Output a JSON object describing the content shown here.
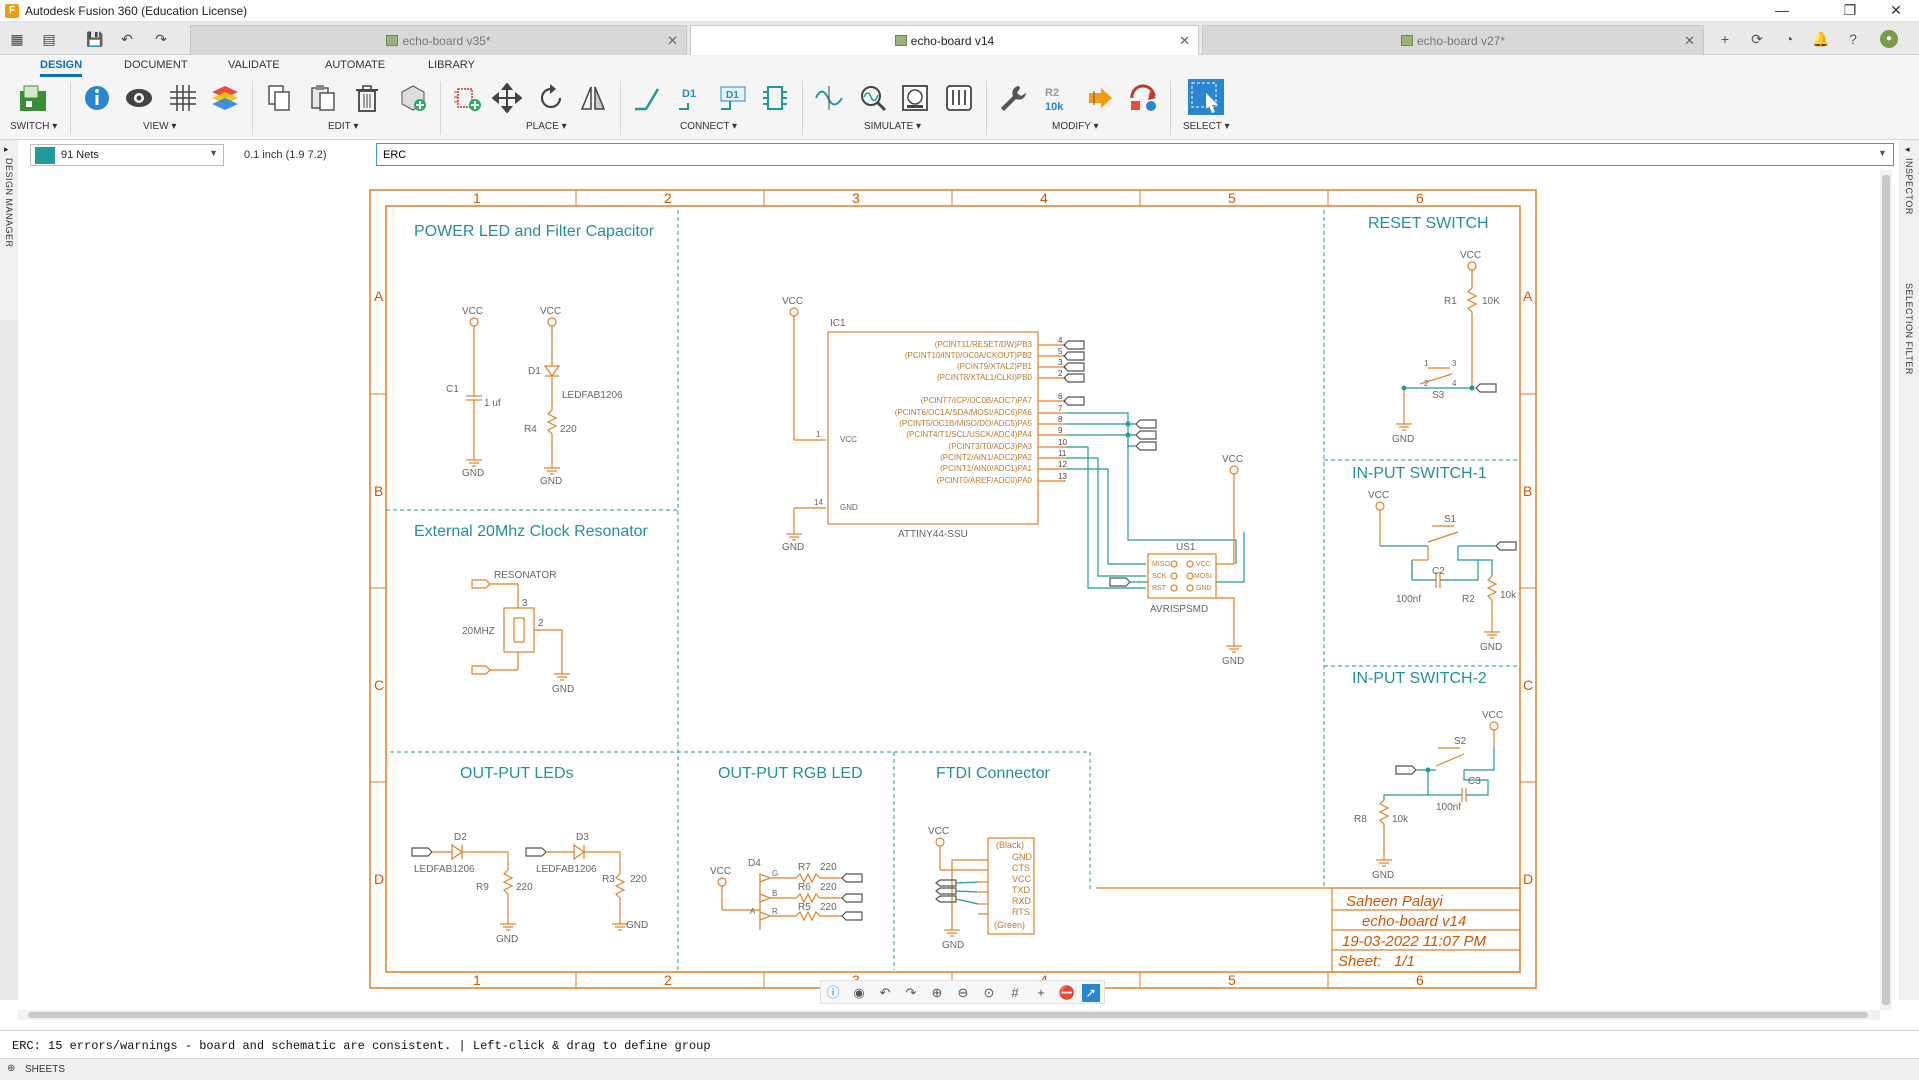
{
  "window": {
    "title": "Autodesk Fusion 360 (Education License)"
  },
  "tabs": [
    {
      "label": "echo-board v35*",
      "active": false
    },
    {
      "label": "echo-board v14",
      "active": true
    },
    {
      "label": "echo-board v27*",
      "active": false
    }
  ],
  "ribbon": {
    "tabs": [
      "DESIGN",
      "DOCUMENT",
      "VALIDATE",
      "AUTOMATE",
      "LIBRARY"
    ],
    "groups": {
      "switch": "SWITCH ▾",
      "view": "VIEW ▾",
      "edit": "EDIT ▾",
      "place": "PLACE ▾",
      "connect": "CONNECT ▾",
      "simulate": "SIMULATE ▾",
      "modify": "MODIFY ▾",
      "select": "SELECT ▾"
    },
    "icon_text": {
      "d1": "D1",
      "r2": "R2",
      "r2_value": "10k"
    }
  },
  "command_row": {
    "nets": "91 Nets",
    "grid": "0.1 inch (1.9 7.2)",
    "command": "ERC"
  },
  "side_panels": {
    "left": "DESIGN MANAGER",
    "right_top": "INSPECTOR",
    "right_bottom": "SELECTION FILTER"
  },
  "schematic": {
    "sections": {
      "power": "POWER LED and Filter Capacitor",
      "clock": "External 20Mhz Clock Resonator",
      "reset": "RESET SWITCH",
      "in1": "IN-PUT SWITCH-1",
      "in2": "IN-PUT SWITCH-2",
      "out_leds": "OUT-PUT LEDs",
      "out_rgb": "OUT-PUT RGB LED",
      "ftdi": "FTDI Connector"
    },
    "cols": [
      "1",
      "2",
      "3",
      "4",
      "5",
      "6"
    ],
    "rows": [
      "A",
      "B",
      "C",
      "D"
    ],
    "labels": {
      "vcc": "VCC",
      "gnd": "GND",
      "c1": "C1",
      "c1_val": "1 uf",
      "d1": "D1",
      "led1206": "LEDFAB1206",
      "r4": "R4",
      "r220": "220",
      "resonator": "RESONATOR",
      "mhz": "20MHZ",
      "ic1": "IC1",
      "attiny": "ATTINY44-SSU",
      "ic_vcc": "VCC",
      "ic_gnd": "GND",
      "p1": "1",
      "p14": "14",
      "us1": "US1",
      "avr": "AVRISPSMD",
      "miso": "MISO",
      "sck": "SCK",
      "rst": "RST",
      "isp_vcc": "VCC",
      "mosi": "MOSI",
      "isp_gnd": "GND",
      "r1": "R1",
      "r10k": "10K",
      "s3": "S3",
      "s1": "S1",
      "s2": "S2",
      "c2": "C2",
      "c3": "C3",
      "c100": "100nf",
      "r2": "R2",
      "r8": "R8",
      "k10": "10k",
      "d2": "D2",
      "d3": "D3",
      "r9": "R9",
      "r3": "R3",
      "d4": "D4",
      "r7": "R7",
      "r6": "R6",
      "r5": "R5",
      "pin_g": "G",
      "pin_b": "B",
      "pin_r": "R",
      "pin_a": "A",
      "sw1": "1",
      "sw2": "2",
      "sw3": "3",
      "sw4": "4",
      "res_pin2": "2",
      "res_pin3": "3"
    },
    "ic_pins": [
      "(PCINT11/RESET/DW)PB3",
      "(PCINT10/INT0/OC0A/CKOUT)PB2",
      "(PCINT9/XTAL2)PB1",
      "(PCINT8/XTAL1/CLKI)PB0",
      "(PCINT7/ICP/OC0B/ADC7)PA7",
      "(PCINT6/OC1A/SDA/MOSI/ADC6)PA6",
      "(PCINT5/OC1B/MISO/DO/ADC5)PA5",
      "(PCINT4/T1/SCL/USCK/ADC4)PA4",
      "(PCINT3/T0/ADC3)PA3",
      "(PCINT2/AIN1/ADC2)PA2",
      "(PCINT1/AIN0/ADC1)PA1",
      "(PCINT0/AREF/ADC0)PA0"
    ],
    "ic_pin_numbers": [
      "4",
      "5",
      "3",
      "2",
      "6",
      "7",
      "8",
      "9",
      "10",
      "11",
      "12",
      "13"
    ],
    "ftdi_pins": [
      "(Black)",
      "GND",
      "CTS",
      "VCC",
      "TXD",
      "RXD",
      "RTS",
      "(Green)"
    ],
    "title_block": {
      "author": "Saheen Palayi",
      "board": "echo-board v14",
      "date": "19-03-2022 11:07 PM",
      "sheet_label": "Sheet:",
      "sheet": "1/1"
    }
  },
  "status": {
    "message": "ERC: 15 errors/warnings - board and schematic are consistent. | Left-click & drag to define group",
    "sheets": "SHEETS"
  },
  "colors": {
    "schematic_frame": "#e67e22",
    "net": "#1f9b9b",
    "accent": "#0a6fc2"
  }
}
